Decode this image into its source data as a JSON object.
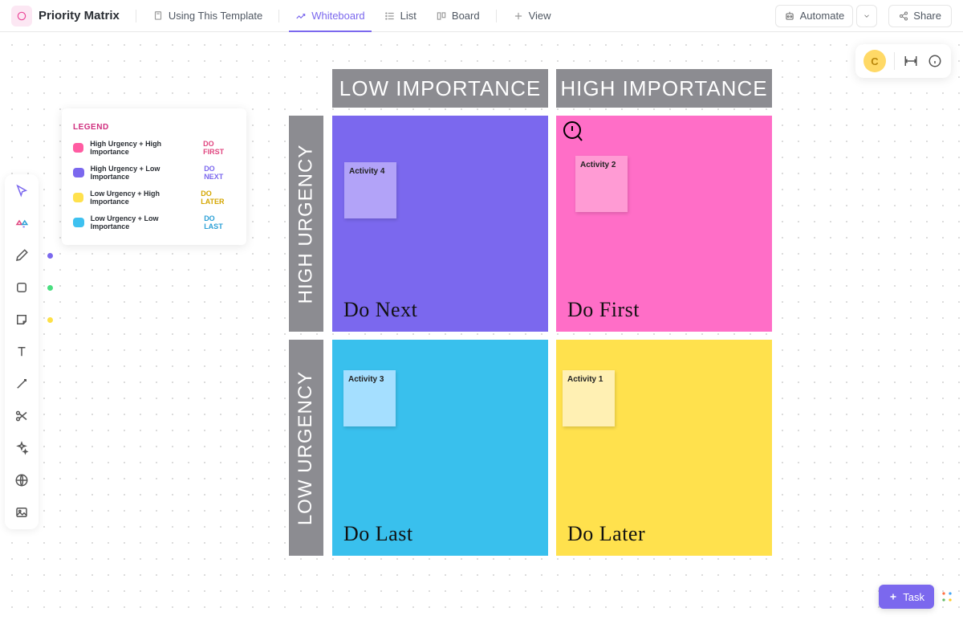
{
  "header": {
    "title": "Priority Matrix",
    "tabs": {
      "template": "Using This Template",
      "whiteboard": "Whiteboard",
      "list": "List",
      "board": "Board",
      "view": "View"
    },
    "automate": "Automate",
    "share": "Share"
  },
  "floatPanel": {
    "avatar": "C"
  },
  "legend": {
    "title": "LEGEND",
    "items": [
      {
        "label": "High Urgency + High Importance",
        "tag": "DO FIRST",
        "swatch": "#ff5ca2",
        "tagColor": "#e0457f"
      },
      {
        "label": "High Urgency + Low Importance",
        "tag": "DO NEXT",
        "swatch": "#7b68ee",
        "tagColor": "#7b68ee"
      },
      {
        "label": "Low Urgency + High Importance",
        "tag": "DO LATER",
        "swatch": "#ffe14d",
        "tagColor": "#d4a600"
      },
      {
        "label": "Low Urgency + Low Importance",
        "tag": "DO LAST",
        "swatch": "#3ec1f0",
        "tagColor": "#2a9fd6"
      }
    ]
  },
  "matrix": {
    "colHeaders": {
      "low": "LOW IMPORTANCE",
      "high": "HIGH IMPORTANCE"
    },
    "rowHeaders": {
      "high": "HIGH URGENCY",
      "low": "LOW URGENCY"
    },
    "quadrants": {
      "topLeft": {
        "bg": "#7b68ee",
        "title": "Do Next",
        "sticky": {
          "text": "Activity 4",
          "bg": "#b2a3f8"
        }
      },
      "topRight": {
        "bg": "#ff6ec7",
        "title": "Do First",
        "sticky": {
          "text": "Activity 2",
          "bg": "#ff9bd4"
        }
      },
      "bottomLeft": {
        "bg": "#39c0ed",
        "title": "Do Last",
        "sticky": {
          "text": "Activity 3",
          "bg": "#a5dfff"
        }
      },
      "bottomRight": {
        "bg": "#ffe14d",
        "title": "Do Later",
        "sticky": {
          "text": "Activity 1",
          "bg": "#fff0b3"
        }
      }
    }
  },
  "taskButton": "Task"
}
